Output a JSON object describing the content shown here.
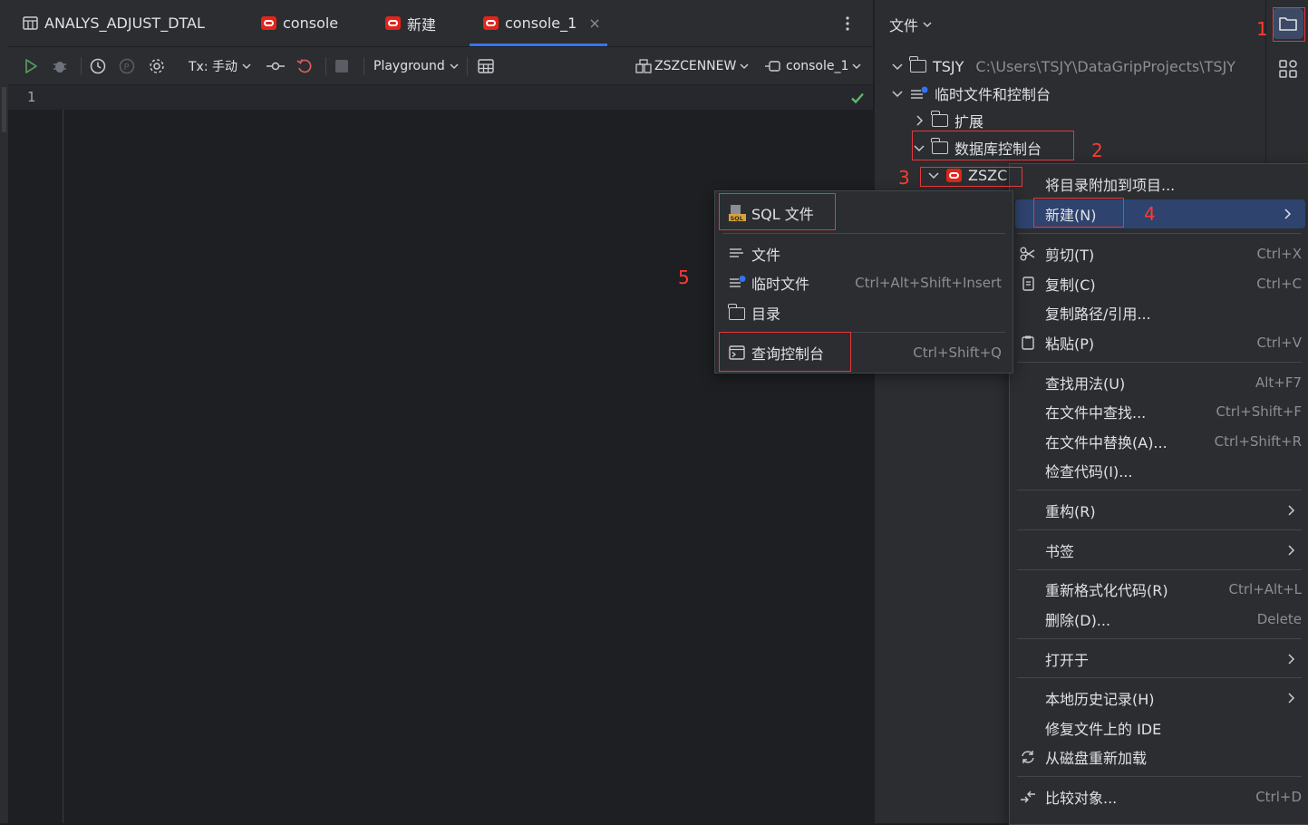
{
  "tabs": [
    {
      "label": "ANALYS_ADJUST_DTAL",
      "icon": "table-icon"
    },
    {
      "label": "console",
      "icon": "oracle-icon"
    },
    {
      "label": "新建",
      "icon": "oracle-icon"
    },
    {
      "label": "console_1",
      "icon": "oracle-icon",
      "active": true,
      "close": "×"
    }
  ],
  "toolbar": {
    "tx": "Tx: 手动",
    "playground": "Playground",
    "datasource": "ZSZCENNEW",
    "session": "console_1"
  },
  "editor": {
    "line_number": "1"
  },
  "project": {
    "header": "文件",
    "root_name": "TSJY",
    "root_path": "C:\\Users\\TSJY\\DataGripProjects\\TSJY",
    "scratches": "临时文件和控制台",
    "extensions": "扩展",
    "db_consoles": "数据库控制台",
    "datasource": "ZSZC"
  },
  "annotations": [
    "1",
    "2",
    "3",
    "4",
    "5"
  ],
  "context_menu": {
    "attach": "将目录附加到项目...",
    "new": "新建(N)",
    "cut": "剪切(T)",
    "cut_sc": "Ctrl+X",
    "copy": "复制(C)",
    "copy_sc": "Ctrl+C",
    "copy_path": "复制路径/引用...",
    "paste": "粘贴(P)",
    "paste_sc": "Ctrl+V",
    "find_usages": "查找用法(U)",
    "find_usages_sc": "Alt+F7",
    "find_in_files": "在文件中查找...",
    "find_in_files_sc": "Ctrl+Shift+F",
    "replace_in_files": "在文件中替换(A)...",
    "replace_in_files_sc": "Ctrl+Shift+R",
    "inspect": "检查代码(I)...",
    "refactor": "重构(R)",
    "bookmarks": "书签",
    "reformat": "重新格式化代码(R)",
    "reformat_sc": "Ctrl+Alt+L",
    "delete": "删除(D)...",
    "delete_sc": "Delete",
    "open_in": "打开于",
    "local_history": "本地历史记录(H)",
    "repair_ide": "修复文件上的 IDE",
    "reload": "从磁盘重新加载",
    "compare": "比较对象...",
    "compare_sc": "Ctrl+D"
  },
  "submenu": {
    "sql_file": "SQL 文件",
    "file": "文件",
    "scratch_file": "临时文件",
    "scratch_file_sc": "Ctrl+Alt+Shift+Insert",
    "directory": "目录",
    "query_console": "查询控制台",
    "query_console_sc": "Ctrl+Shift+Q"
  },
  "colors": {
    "accent": "#3574f0",
    "annotation_red": "#e5383b",
    "oracle_red": "#e0251b",
    "highlight": "#2e436e"
  }
}
